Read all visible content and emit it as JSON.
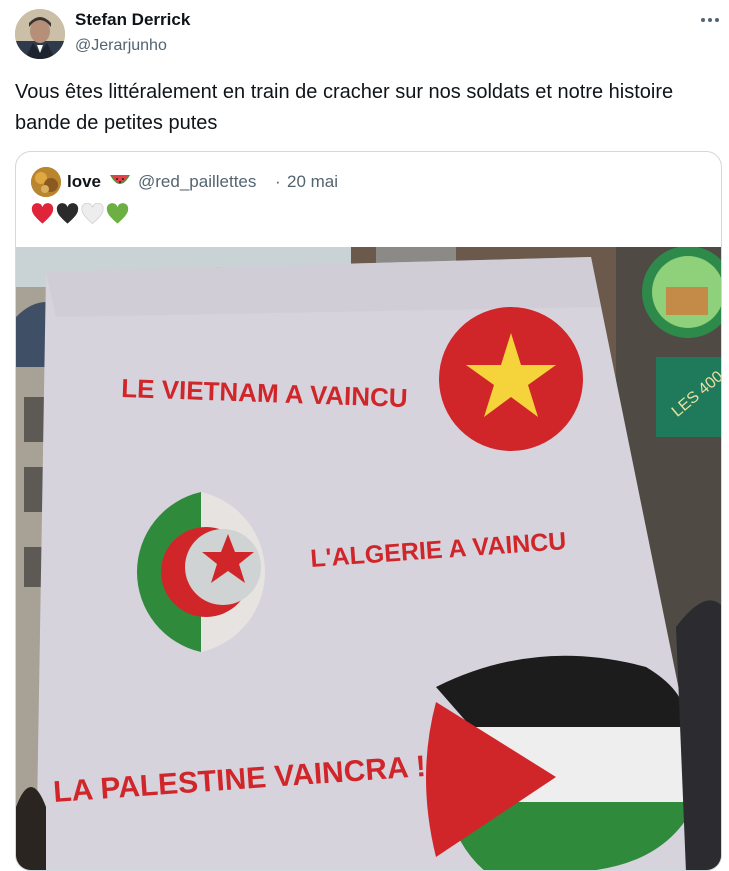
{
  "tweet": {
    "author_name": "Stefan Derrick",
    "author_handle": "@Jerarjunho",
    "text": "Vous êtes littéralement en train de cracher sur nos soldats et notre histoire bande de petites putes"
  },
  "quoted_tweet": {
    "author_name": "love",
    "author_emoji": "watermelon-emoji",
    "author_handle": "@red_paillettes",
    "separator": "·",
    "date": "20 mai",
    "hearts": [
      "red-heart-icon",
      "black-heart-icon",
      "white-heart-icon",
      "green-heart-icon"
    ],
    "image": {
      "banner_line_1": "LE VIETNAM A VAINCU",
      "banner_line_2": "L'ALGERIE A VAINCU",
      "banner_line_3": "LA PALESTINE VAINCRA !",
      "shop_sign": "LES 400",
      "colors": {
        "paint_red": "#d0262a",
        "sky": "#c9d3d6",
        "cloth": "#d6d3dd"
      }
    }
  }
}
